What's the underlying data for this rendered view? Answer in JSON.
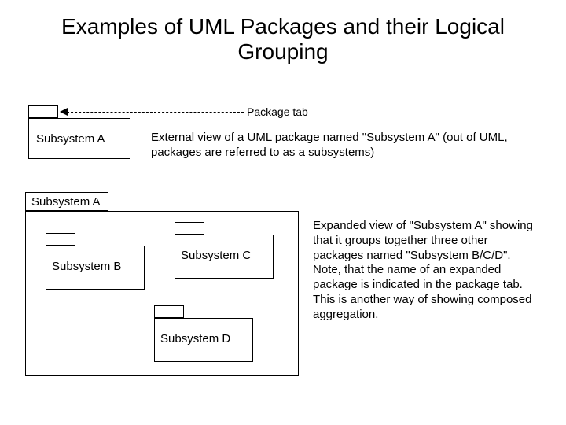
{
  "title": "Examples of UML Packages and their Logical Grouping",
  "labels": {
    "package_tab": "Package tab",
    "external_view": "External view of a UML package named \"Subsystem A\" (out of UML, packages are referred to as a subsystems)",
    "expanded_view": "Expanded view of \"Subsystem A\" showing that it groups together three other packages named \"Subsystem B/C/D\". Note, that the name of an expanded package is indicated in the package tab. This is another way of showing composed aggregation."
  },
  "packages": {
    "small": {
      "name": "Subsystem A"
    },
    "large": {
      "name": "Subsystem A",
      "children": {
        "b": "Subsystem B",
        "c": "Subsystem C",
        "d": "Subsystem D"
      }
    }
  }
}
